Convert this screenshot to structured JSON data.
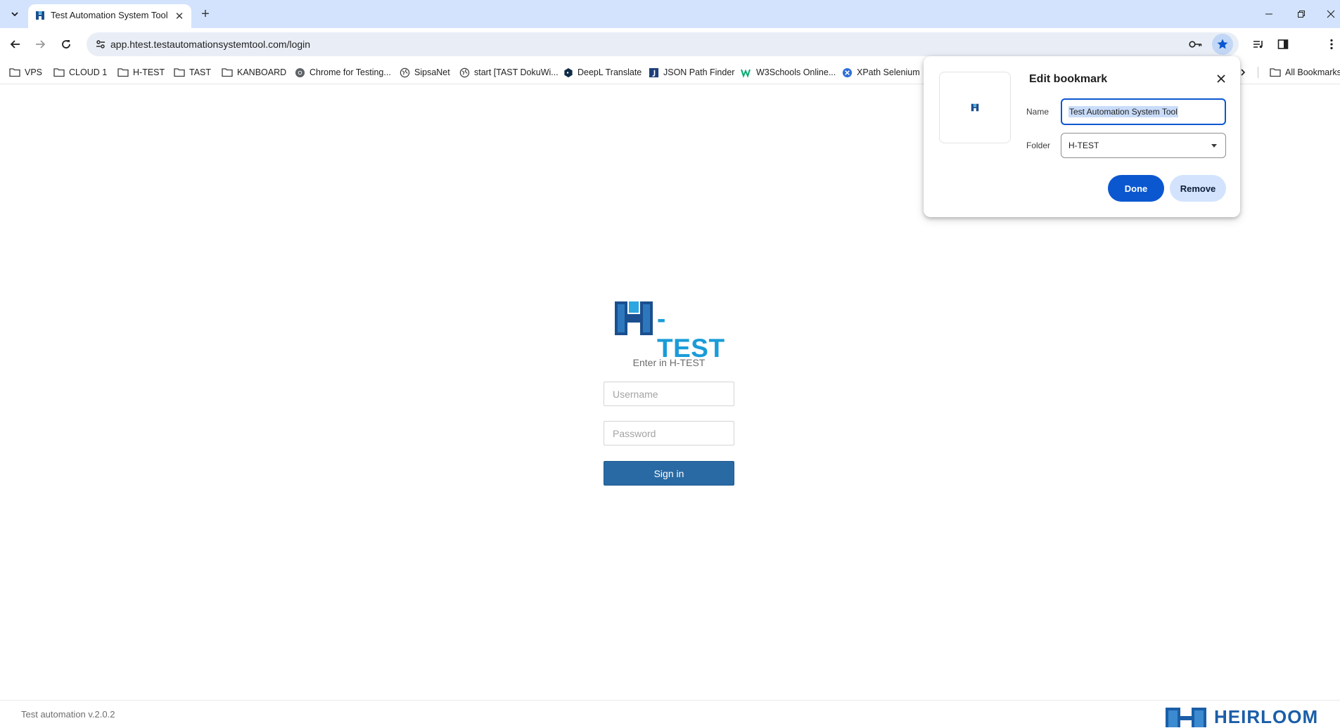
{
  "browser": {
    "tab": {
      "title": "Test Automation System Tool"
    },
    "address": {
      "url": "app.htest.testautomationsystemtool.com/login"
    },
    "bookmarks": [
      {
        "label": "VPS",
        "icon": "folder-icon"
      },
      {
        "label": "CLOUD 1",
        "icon": "folder-icon"
      },
      {
        "label": "H-TEST",
        "icon": "folder-icon"
      },
      {
        "label": "TAST",
        "icon": "folder-icon"
      },
      {
        "label": "KANBOARD",
        "icon": "folder-icon"
      },
      {
        "label": "Chrome for Testing...",
        "icon": "chrome-icon"
      },
      {
        "label": "SipsaNet",
        "icon": "globe-icon"
      },
      {
        "label": "start [TAST DokuWi...",
        "icon": "globe-icon"
      },
      {
        "label": "DeepL Translate",
        "icon": "deepl-icon"
      },
      {
        "label": "JSON Path Finder",
        "icon": "json-icon"
      },
      {
        "label": "W3Schools Online...",
        "icon": "w3schools-icon"
      },
      {
        "label": "XPath Selenium",
        "icon": "xpath-icon"
      }
    ],
    "all_bookmarks": "All Bookmarks"
  },
  "bookmark_popup": {
    "title": "Edit bookmark",
    "name_label": "Name",
    "name_value": "Test Automation System Tool",
    "folder_label": "Folder",
    "folder_value": "H-TEST",
    "done_label": "Done",
    "remove_label": "Remove"
  },
  "login": {
    "logo_text": "-TEST",
    "subtitle": "Enter in H-TEST",
    "username_placeholder": "Username",
    "password_placeholder": "Password",
    "signin_label": "Sign in"
  },
  "footer": {
    "version": "Test automation v.2.0.2",
    "brand": "HEIRLOOM"
  },
  "colors": {
    "tabstrip": "#d3e3fd",
    "accent": "#0b57d0",
    "logo_blue": "#1a9cd8",
    "signin_blue": "#2a6aa4",
    "heirloom_blue": "#1b5ea8"
  }
}
